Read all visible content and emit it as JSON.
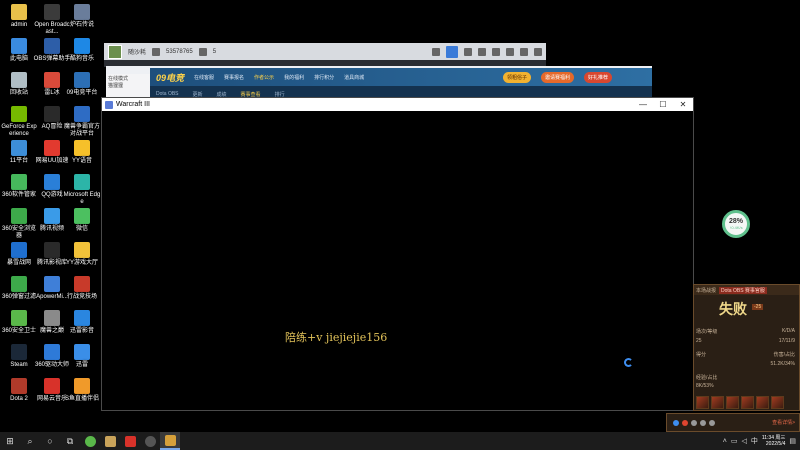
{
  "desktop_icons": [
    {
      "label": "admin",
      "color": "#e8c04a"
    },
    {
      "label": "Open Broadcast...",
      "color": "#3b3b3b"
    },
    {
      "label": "炉石传说",
      "color": "#6a7d9b"
    },
    {
      "label": "此电脑",
      "color": "#3a8be0"
    },
    {
      "label": "OBS弹幕助手",
      "color": "#2d5ea8"
    },
    {
      "label": "酷狗音乐",
      "color": "#1e88e5"
    },
    {
      "label": "回收站",
      "color": "#b0bec5"
    },
    {
      "label": "雷L冰",
      "color": "#d94a3a"
    },
    {
      "label": "09电竞平台",
      "color": "#2c6fb6"
    },
    {
      "label": "GeForce Experience",
      "color": "#76b900"
    },
    {
      "label": "AQ冒险",
      "color": "#2a2a2a"
    },
    {
      "label": "魔兽争霸官方对战平台",
      "color": "#2e6cc4"
    },
    {
      "label": "11平台",
      "color": "#3d8ed8"
    },
    {
      "label": "网易UU加速",
      "color": "#e23a2f"
    },
    {
      "label": "YY语音",
      "color": "#f6c02a"
    },
    {
      "label": "360软件管家",
      "color": "#46b85c"
    },
    {
      "label": "QQ游戏",
      "color": "#2a7fd8"
    },
    {
      "label": "Microsoft Edge",
      "color": "#2cb5a8"
    },
    {
      "label": "360安全浏览器",
      "color": "#3daa4a"
    },
    {
      "label": "腾讯视频",
      "color": "#3a9be8"
    },
    {
      "label": "微信",
      "color": "#4cc060"
    },
    {
      "label": "暴雪战网",
      "color": "#1f6fcf"
    },
    {
      "label": "腾讯影视库",
      "color": "#2a2a2a"
    },
    {
      "label": "YY游戏大厅",
      "color": "#f2c23a"
    },
    {
      "label": "360弹窗过滤",
      "color": "#3daa4a"
    },
    {
      "label": "ApowerMi...",
      "color": "#3f7fd8"
    },
    {
      "label": "行战竞技场",
      "color": "#c83a2a"
    },
    {
      "label": "360安全卫士",
      "color": "#5ab84a"
    },
    {
      "label": "魔兽之巅",
      "color": "#8a8a8a"
    },
    {
      "label": "迅雷影音",
      "color": "#2a86e0"
    },
    {
      "label": "Steam",
      "color": "#1b2838"
    },
    {
      "label": "360驱动大师",
      "color": "#2e7ad8"
    },
    {
      "label": "迅雷",
      "color": "#3a8ee8"
    },
    {
      "label": "Dota 2",
      "color": "#b03a2a"
    },
    {
      "label": "网易云音乐",
      "color": "#d8322a"
    },
    {
      "label": "S鱼直播伴侣",
      "color": "#f09a2a"
    }
  ],
  "platform_window": {
    "name": "随沙耗",
    "id": "53578765",
    "count": "5"
  },
  "platform2": {
    "logo": "09电竞",
    "nav": [
      "在线客服",
      "赛事报名",
      "作者公示",
      "我的福利",
      "排行积分",
      "道具商城"
    ],
    "btn_yellow": "领粗俗子",
    "btn_orange": "邀请赛福利",
    "btn_red": "好礼推荐",
    "side_lines": [
      "在线模式",
      "猫狸狸"
    ],
    "sub_items": [
      "Dota OBS",
      "更新",
      "成绩",
      "赛事查看",
      "排行"
    ]
  },
  "warcraft": {
    "title": "Warcraft III",
    "overlay": "陪练+v  jiejiejie156"
  },
  "float_ball": {
    "percent": "28%",
    "sub": "↑0.4K/s"
  },
  "result_panel": {
    "header": "本场战报",
    "header_tag": "Dota OBS 赛事官服",
    "result": "失败",
    "score_tag": "-25",
    "rows": [
      {
        "left": "场次/等级",
        "right": "K/D/A"
      },
      {
        "left": "25",
        "right": "17/11/9"
      },
      {
        "left": "得分",
        "right": "伤害/占比"
      },
      {
        "left": "",
        "right": "51.2K/34%"
      },
      {
        "left": "经验/占比",
        "right": ""
      },
      {
        "left": "8K/53%",
        "right": ""
      }
    ],
    "footer_link": "查看详情>"
  },
  "taskbar": {
    "time": "11:34 周三",
    "date": "2022/5/4"
  },
  "colors": {
    "accent": "#3b7bd8",
    "lose_gold": "#f0d88a",
    "overlay_gold": "#e3c35a"
  }
}
